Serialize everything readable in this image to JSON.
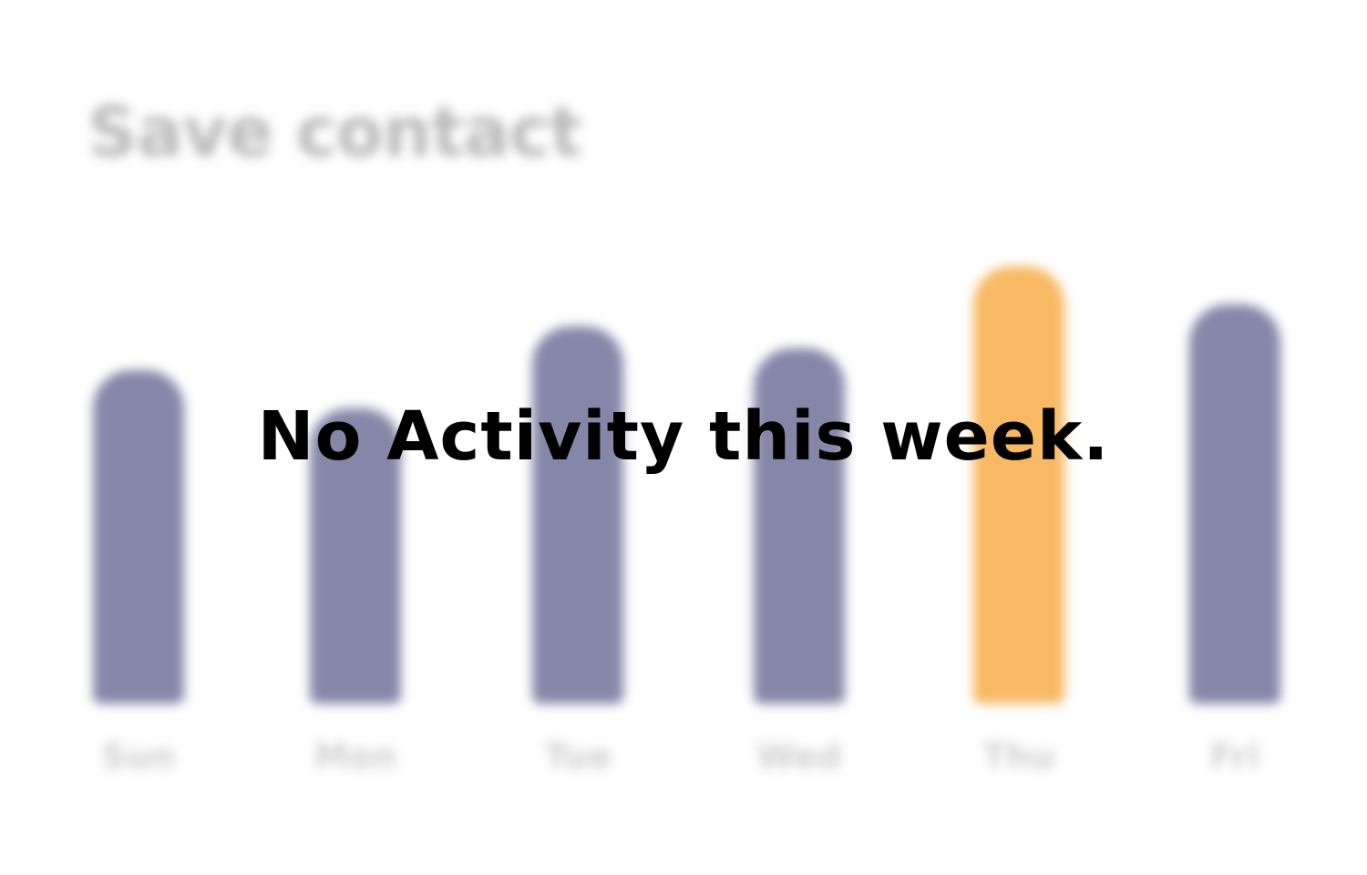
{
  "card": {
    "title": "Save contact"
  },
  "chart_data": {
    "type": "bar",
    "categories": [
      "Sun",
      "Mon",
      "Tue",
      "Wed",
      "Thu",
      "Fri"
    ],
    "values": [
      61,
      54,
      69,
      65,
      80,
      73
    ],
    "highlight_index": 4,
    "colors": {
      "bar": "#8686a8",
      "highlight": "#f7b964"
    }
  },
  "empty_state": {
    "message": "No Activity this week."
  }
}
